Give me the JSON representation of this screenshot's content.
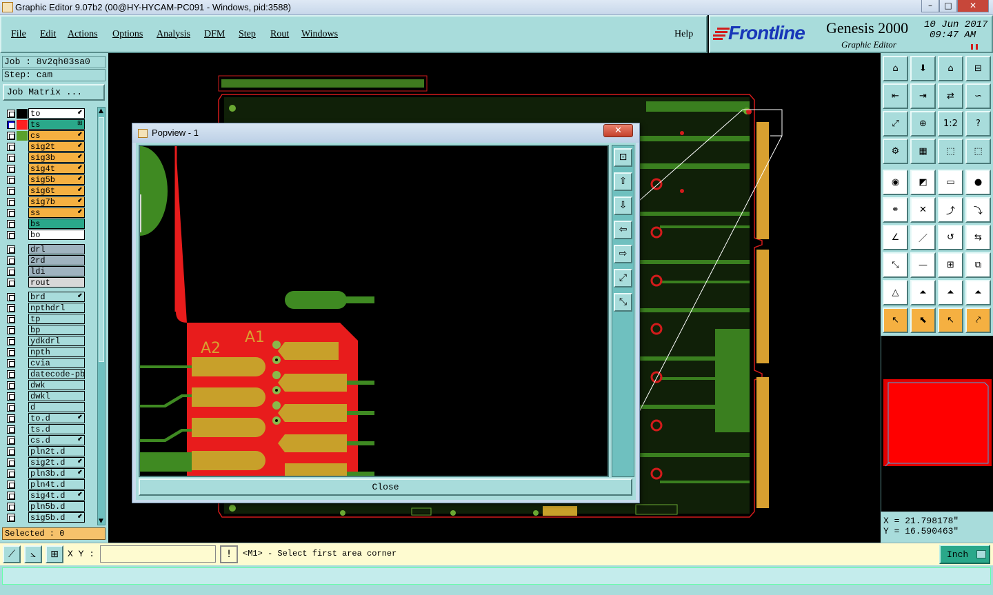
{
  "window": {
    "title": "Graphic Editor 9.07b2 (00@HY-HYCAM-PC091 - Windows, pid:3588)"
  },
  "menu": [
    "File",
    "Edit",
    "Actions",
    "Options",
    "Analysis",
    "DFM",
    "Step",
    "Rout",
    "Windows"
  ],
  "help_label": "Help",
  "brand": {
    "logo": "Frontline",
    "product": "Genesis 2000",
    "subtitle": "Graphic Editor",
    "date": "10 Jun 2017",
    "time": "09:47 AM"
  },
  "job": {
    "job_label": "Job : 8v2qh03sa0",
    "step_label": "Step: cam",
    "matrix_button": "Job Matrix ..."
  },
  "layers": [
    {
      "name": "to",
      "color": "#ffffff",
      "swatch": "#000000",
      "flag": "⬋"
    },
    {
      "name": "ts",
      "color": "#2aa88a",
      "swatch": "#ff2020",
      "flag": "⊞",
      "active": true
    },
    {
      "name": "cs",
      "color": "#f5b041",
      "swatch": "#5aa02c",
      "flag": "⬋"
    },
    {
      "name": "sig2t",
      "color": "#f5b041",
      "swatch": "",
      "flag": "⬋"
    },
    {
      "name": "sig3b",
      "color": "#f5b041",
      "swatch": "",
      "flag": "⬋"
    },
    {
      "name": "sig4t",
      "color": "#f5b041",
      "swatch": "",
      "flag": "⬋"
    },
    {
      "name": "sig5b",
      "color": "#f5b041",
      "swatch": "",
      "flag": "⬋"
    },
    {
      "name": "sig6t",
      "color": "#f5b041",
      "swatch": "",
      "flag": "⬋"
    },
    {
      "name": "sig7b",
      "color": "#f5b041",
      "swatch": "",
      "flag": "⬋"
    },
    {
      "name": "ss",
      "color": "#f5b041",
      "swatch": "",
      "flag": "⬋"
    },
    {
      "name": "bs",
      "color": "#2aa88a",
      "swatch": "",
      "flag": ""
    },
    {
      "name": "bo",
      "color": "#ffffff",
      "swatch": "",
      "flag": ""
    },
    {
      "name": "drl",
      "color": "#9fb3bf",
      "swatch": "",
      "flag": ""
    },
    {
      "name": "2rd",
      "color": "#9fb3bf",
      "swatch": "",
      "flag": ""
    },
    {
      "name": "ldi",
      "color": "#9fb3bf",
      "swatch": "",
      "flag": ""
    },
    {
      "name": "rout",
      "color": "#d8d8d8",
      "swatch": "",
      "flag": ""
    },
    {
      "name": "brd",
      "color": "#a8dcdb",
      "swatch": "",
      "flag": "⬋"
    },
    {
      "name": "npthdrl",
      "color": "#a8dcdb",
      "swatch": "",
      "flag": ""
    },
    {
      "name": "tp",
      "color": "#a8dcdb",
      "swatch": "",
      "flag": ""
    },
    {
      "name": "bp",
      "color": "#a8dcdb",
      "swatch": "",
      "flag": ""
    },
    {
      "name": "ydkdrl",
      "color": "#a8dcdb",
      "swatch": "",
      "flag": ""
    },
    {
      "name": "npth",
      "color": "#a8dcdb",
      "swatch": "",
      "flag": ""
    },
    {
      "name": "cvia",
      "color": "#a8dcdb",
      "swatch": "",
      "flag": ""
    },
    {
      "name": "datecode-pbe",
      "color": "#a8dcdb",
      "swatch": "",
      "flag": ""
    },
    {
      "name": "dwk",
      "color": "#a8dcdb",
      "swatch": "",
      "flag": ""
    },
    {
      "name": "dwkl",
      "color": "#a8dcdb",
      "swatch": "",
      "flag": ""
    },
    {
      "name": "d",
      "color": "#a8dcdb",
      "swatch": "",
      "flag": ""
    },
    {
      "name": "to.d",
      "color": "#a8dcdb",
      "swatch": "",
      "flag": "⬋"
    },
    {
      "name": "ts.d",
      "color": "#a8dcdb",
      "swatch": "",
      "flag": ""
    },
    {
      "name": "cs.d",
      "color": "#a8dcdb",
      "swatch": "",
      "flag": "⬋"
    },
    {
      "name": "pln2t.d",
      "color": "#a8dcdb",
      "swatch": "",
      "flag": ""
    },
    {
      "name": "sig2t.d",
      "color": "#a8dcdb",
      "swatch": "",
      "flag": "⬋"
    },
    {
      "name": "pln3b.d",
      "color": "#a8dcdb",
      "swatch": "",
      "flag": "⬋"
    },
    {
      "name": "pln4t.d",
      "color": "#a8dcdb",
      "swatch": "",
      "flag": ""
    },
    {
      "name": "sig4t.d",
      "color": "#a8dcdb",
      "swatch": "",
      "flag": "⬋"
    },
    {
      "name": "pln5b.d",
      "color": "#a8dcdb",
      "swatch": "",
      "flag": ""
    },
    {
      "name": "sig5b.d",
      "color": "#a8dcdb",
      "swatch": "",
      "flag": "⬋"
    }
  ],
  "selected": "Selected : 0",
  "popview": {
    "title": "Popview - 1",
    "close_label": "Close",
    "pad_labels": [
      "A2",
      "A1"
    ]
  },
  "coords": {
    "x": "X = 21.798178\"",
    "y": "Y = 16.590463\""
  },
  "status": {
    "xy_label": "X Y :",
    "xy_value": "",
    "message": "<M1> - Select first area corner",
    "units": "Inch"
  },
  "colors": {
    "panel": "#a8dcdb",
    "accent": "#f5b041",
    "copper": "#5aa02c",
    "mask": "#ff2020"
  }
}
